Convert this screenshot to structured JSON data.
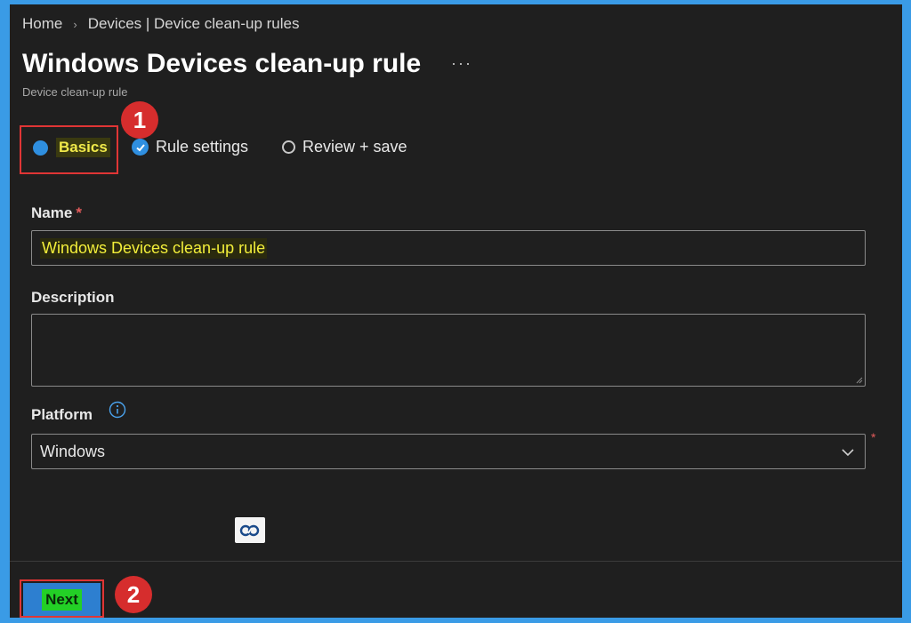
{
  "breadcrumb": {
    "home": "Home",
    "separator": "›",
    "current": "Devices | Device clean-up rules"
  },
  "page": {
    "title": "Windows Devices clean-up rule",
    "more": "···",
    "subtitle": "Device clean-up rule"
  },
  "steps": [
    {
      "label": "Basics",
      "state": "current"
    },
    {
      "label": "Rule settings",
      "state": "completed"
    },
    {
      "label": "Review + save",
      "state": "pending"
    }
  ],
  "annotations": {
    "badge1": "1",
    "badge2": "2"
  },
  "form": {
    "name_label": "Name",
    "required_marker": "*",
    "name_value": "Windows Devices clean-up rule",
    "description_label": "Description",
    "description_value": "",
    "platform_label": "Platform",
    "platform_value": "Windows"
  },
  "footer": {
    "next_label": "Next"
  },
  "icons": {
    "info": "info-icon",
    "chevron": "chevron-down-icon",
    "check": "check-icon",
    "logo": "site-logo-icon"
  },
  "colors": {
    "background": "#1f1f1f",
    "accent": "#2f8fe0",
    "annotation": "#e03535",
    "highlight": "#f2ee3a"
  }
}
